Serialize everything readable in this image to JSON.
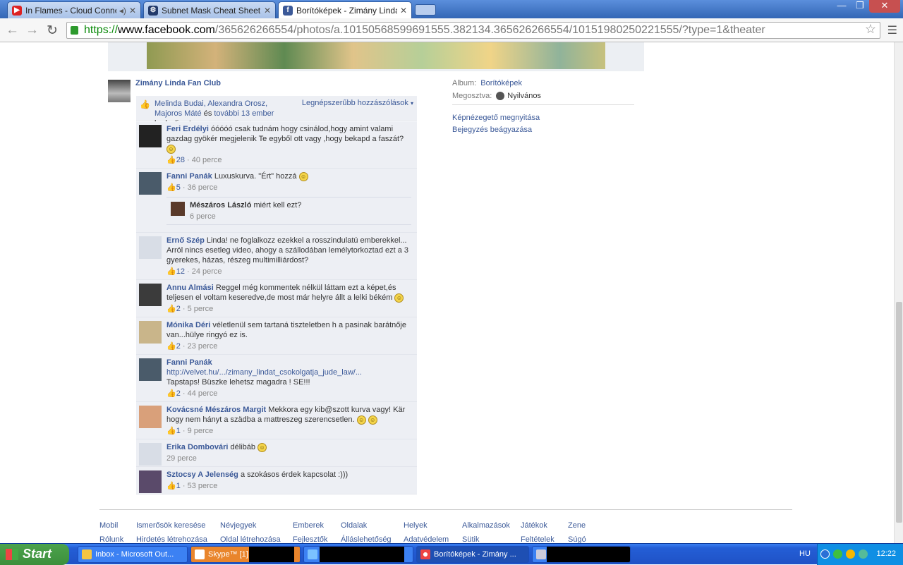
{
  "tabs": [
    {
      "title": "In Flames - Cloud Connec",
      "icon": "youtube-icon"
    },
    {
      "title": "Subnet Mask Cheat Sheet",
      "icon": "subnet-site-icon"
    },
    {
      "title": "Borítóképek - Zimány Linda F",
      "icon": "facebook-icon"
    }
  ],
  "address": {
    "scheme": "https://",
    "domain": "www.facebook.com",
    "path": "/365626266554/photos/a.10150568599691555.382134.365626266554/10151980250221555/?type=1&theater"
  },
  "post": {
    "owner": "Zimány Linda Fan Club"
  },
  "likes": {
    "names": "Melinda Budai, Alexandra Orosz, Majoros Máté",
    "and": " és ",
    "others": "további 13 ember",
    "suffix": " kedveli ezt.",
    "sort": "Legnépszerűbb hozzászólások"
  },
  "comments": [
    {
      "name": "Feri Erdélyi",
      "text": "óóóóó csak tudnám hogy csinálod,hogy amint valami gazdag gyökér megjelenik Te egyből ott vagy ,hogy bekapd a faszát?",
      "smiles": 1,
      "likes": "28",
      "time": "40 perce",
      "avatar": "#222"
    },
    {
      "name": "Fanni Panák",
      "text": "Luxuskurva. \"Ért\" hozzá",
      "smiles": 1,
      "likes": "5",
      "time": "36 perce",
      "avatar": "#4a5b6a"
    },
    {
      "name": "Ernő Szép",
      "text": "Linda! ne foglalkozz ezekkel a rosszindulatú emberekkel... Arról nincs esetleg video, ahogy a szállodában lemélytorkoztad ezt a 3 gyerekes, házas, részeg multimilliárdost?",
      "smiles": 0,
      "likes": "12",
      "time": "24 perce",
      "avatar": "#d8dde6"
    },
    {
      "name": "Annu Almási",
      "text": "Reggel még kommentek nélkül láttam ezt a képet,és teljesen el voltam keseredve,de most már helyre állt a lelki békém",
      "smiles": 1,
      "likes": "2",
      "time": "5 perce",
      "avatar": "#3b3b3b"
    },
    {
      "name": "Mónika Déri",
      "text": "véletlenül sem tartaná tiszteletben h a pasinak barátnője van...hülye ringyó ez is.",
      "smiles": 0,
      "likes": "2",
      "time": "23 perce",
      "avatar": "#c9b58a"
    },
    {
      "name": "Fanni Panák",
      "text": "",
      "link": "http://velvet.hu/.../zimany_lindat_csokolgatja_jude_law/...",
      "line2": "Tapstaps! Büszke lehetsz magadra ! SE!!!",
      "smiles": 0,
      "likes": "2",
      "time": "44 perce",
      "avatar": "#4a5b6a"
    },
    {
      "name": "Kovácsné Mészáros Margit",
      "text": "Mekkora egy kib@szott kurva vagy! Kär hogy nem hányt a szädba a mattreszeg szerencsetlen.",
      "smiles": 2,
      "likes": "1",
      "time": "9 perce",
      "avatar": "#d9a07a"
    },
    {
      "name": "Erika Dombovári",
      "text": "délibáb",
      "smiles": 1,
      "likes": "",
      "time": "29 perce",
      "avatar": "#d8dde6"
    },
    {
      "name": "Sztocsy A Jelenség",
      "text": "a szokásos érdek kapcsolat :)))",
      "smiles": 0,
      "likes": "1",
      "time": "53 perce",
      "avatar": "#5a4a6a"
    }
  ],
  "reply": {
    "name": "Mészáros László",
    "text": "miért kell ezt?",
    "time": "6 perce"
  },
  "sidebar": {
    "album_label": "Album:",
    "album": "Borítóképek",
    "shared_label": "Megosztva:",
    "shared": "Nyilvános",
    "viewer": "Képnézegető megnyitása",
    "embed": "Bejegyzés beágyazása"
  },
  "footer": [
    [
      "Mobil",
      "Rólunk"
    ],
    [
      "Ismerősök keresése",
      "Hirdetés létrehozása"
    ],
    [
      "Névjegyek",
      "Oldal létrehozása"
    ],
    [
      "Emberek",
      "Fejlesztők"
    ],
    [
      "Oldalak",
      "Álláslehetőség"
    ],
    [
      "Helyek",
      "Adatvédelem"
    ],
    [
      "Alkalmazások",
      "Sütik"
    ],
    [
      "Játékok",
      "Feltételek"
    ],
    [
      "Zene",
      "Súgó"
    ]
  ],
  "taskbar": {
    "start": "Start",
    "items": [
      "Inbox - Microsoft Out...",
      "Skype™ [1]",
      "",
      "Borítóképek - Zimány ...",
      ""
    ],
    "lang": "HU",
    "clock": "12:22"
  }
}
